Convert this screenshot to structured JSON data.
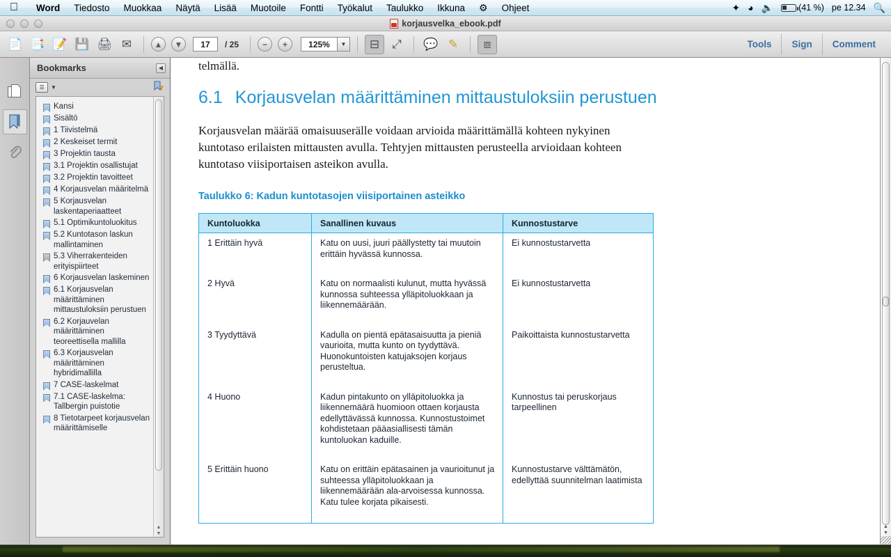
{
  "menubar": {
    "apple_icon": "apple-icon",
    "items": [
      {
        "label": "Word",
        "bold": true
      },
      {
        "label": "Tiedosto",
        "bold": false
      },
      {
        "label": "Muokkaa",
        "bold": false
      },
      {
        "label": "Näytä",
        "bold": false
      },
      {
        "label": "Lisää",
        "bold": false
      },
      {
        "label": "Muotoile",
        "bold": false
      },
      {
        "label": "Fontti",
        "bold": false
      },
      {
        "label": "Työkalut",
        "bold": false
      },
      {
        "label": "Taulukko",
        "bold": false
      },
      {
        "label": "Ikkuna",
        "bold": false
      },
      {
        "label": "Ohjeet",
        "bold": false
      }
    ],
    "status": {
      "dropbox_icon": "dropbox-icon",
      "wifi_icon": "wifi-icon",
      "volume_icon": "volume-icon",
      "battery_icon": "battery-icon",
      "battery_percent": "(41 %)",
      "clock": "pe 12.34",
      "spotlight_icon": "search-icon"
    }
  },
  "window": {
    "title": "korjausvelka_ebook.pdf",
    "file_icon": "pdf-file-icon"
  },
  "toolbar": {
    "buttons": [
      {
        "name": "open-file-button",
        "glyph": "📄"
      },
      {
        "name": "create-pdf-button",
        "glyph": "📑"
      },
      {
        "name": "edit-pdf-button",
        "glyph": "📝"
      },
      {
        "name": "save-button",
        "glyph": "💾"
      },
      {
        "name": "print-button",
        "glyph": "🖨"
      },
      {
        "name": "email-button",
        "glyph": "✉"
      }
    ],
    "prev_page_glyph": "⬆",
    "next_page_glyph": "⬇",
    "current_page": "17",
    "page_total": "/ 25",
    "zoom_out_glyph": "−",
    "zoom_in_glyph": "+",
    "zoom_value": "125%",
    "zoom_caret": "▼",
    "fit_width_glyph": "⊟",
    "fit_page_glyph": "⛶",
    "comment_glyph": "💬",
    "highlight_glyph": "✎",
    "fullscreen_glyph": "⤢",
    "right_links": [
      {
        "name": "tools-button",
        "label": "Tools"
      },
      {
        "name": "sign-button",
        "label": "Sign"
      },
      {
        "name": "comment-button",
        "label": "Comment"
      }
    ]
  },
  "rail": {
    "items": [
      {
        "name": "page-thumbnails-icon",
        "active": false
      },
      {
        "name": "bookmarks-icon",
        "active": true
      },
      {
        "name": "attachments-icon",
        "active": false
      }
    ]
  },
  "bookmarks_panel": {
    "title": "Bookmarks",
    "collapse_glyph": "◀",
    "options_icon": "options-list-icon",
    "options_caret": "▼",
    "new_bookmark_icon": "new-bookmark-icon",
    "items": [
      {
        "label": "Kansi",
        "grey": false
      },
      {
        "label": "Sisältö",
        "grey": false
      },
      {
        "label": "1 Tiivistelmä",
        "grey": false
      },
      {
        "label": "2 Keskeiset termit",
        "grey": false
      },
      {
        "label": "3 Projektin tausta",
        "grey": false
      },
      {
        "label": "3.1 Projektin osallistujat",
        "grey": false
      },
      {
        "label": "3.2 Projektin tavoitteet",
        "grey": false
      },
      {
        "label": "4 Korjausvelan määritelmä",
        "grey": false
      },
      {
        "label": "5 Korjausvelan laskentaperiaatteet",
        "grey": false
      },
      {
        "label": "5.1 Optimikuntoluokitus",
        "grey": false
      },
      {
        "label": "5.2 Kuntotason laskun mallintaminen",
        "grey": false
      },
      {
        "label": "5.3 Viherrakenteiden erityispiirteet",
        "grey": true
      },
      {
        "label": "6 Korjausvelan laskeminen",
        "grey": false
      },
      {
        "label": "6.1 Korjausvelan määrittäminen mittaustuloksiin perustuen",
        "grey": false
      },
      {
        "label": "6.2 Korjauvelan määrittäminen teoreettisella mallilla",
        "grey": false
      },
      {
        "label": "6.3 Korjausvelan määrittäminen hybridimallilla",
        "grey": false
      },
      {
        "label": "7 CASE-laskelmat",
        "grey": false
      },
      {
        "label": "7.1 CASE-laskelma: Tallbergin puistotie",
        "grey": false
      },
      {
        "label": "8 Tietotarpeet korjausvelan määrittämiselle",
        "grey": false
      }
    ]
  },
  "document": {
    "partial_line": "telmällä.",
    "heading_number": "6.1",
    "heading_text": "Korjausvelan määrittäminen mittaustuloksiin perustuen",
    "paragraph": "Korjausvelan määrää omaisuuserälle voidaan arvioida määrittämällä kohteen nykyinen kuntotaso erilaisten mittausten avulla. Tehtyjen mittausten perusteella arvioidaan kohteen kuntotaso viisiportaisen asteikon avulla.",
    "table_caption": "Taulukko 6: Kadun kuntotasojen viisiportainen asteikko",
    "table": {
      "headers": [
        "Kuntoluokka",
        "Sanallinen kuvaus",
        "Kunnostustarve"
      ],
      "rows": [
        {
          "luokka": "1 Erittäin hyvä",
          "kuvaus": "Katu on uusi, juuri päällystetty tai muutoin erittäin hyvässä kunnossa.",
          "tarve": "Ei kunnostustarvetta"
        },
        {
          "luokka": "2 Hyvä",
          "kuvaus": "Katu on normaalisti kulunut, mutta hyvässä kunnossa suhteessa ylläpitoluokkaan ja liikennemäärään.",
          "tarve": "Ei kunnostustarvetta"
        },
        {
          "luokka": "3 Tyydyttävä",
          "kuvaus": "Kadulla on pientä epätasaisuutta ja pieniä vaurioita, mutta kunto on tyydyttävä. Huonokuntoisten katujaksojen korjaus perusteltua.",
          "tarve": "Paikoittaista kunnostustarvetta"
        },
        {
          "luokka": "4 Huono",
          "kuvaus": "Kadun pintakunto on ylläpitoluokka ja liikennemäärä huomioon ottaen korjausta edellyttävässä kunnossa. Kunnostustoimet kohdistetaan pääasiallisesti tämän kuntoluokan kaduille.",
          "tarve": "Kunnostus tai peruskorjaus tarpeellinen"
        },
        {
          "luokka": "5 Erittäin huono",
          "kuvaus": "Katu on erittäin epätasainen ja vaurioitunut ja suhteessa ylläpitoluokkaan ja liikennemäärään ala-arvoisessa kunnossa. Katu tulee korjata pikaisesti.",
          "tarve": "Kunnostustarve välttämätön, edellyttää suunnitelman laatimista"
        }
      ]
    }
  },
  "colors": {
    "accent_blue": "#2196d4",
    "table_header_bg": "#bfe7f7",
    "table_border": "#2aaae0",
    "link_blue": "#3c6ea5"
  }
}
